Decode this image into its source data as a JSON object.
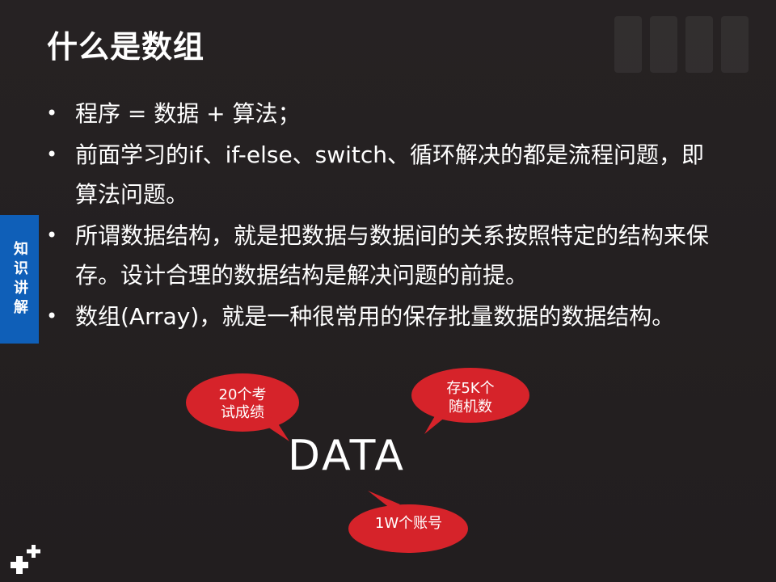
{
  "slide": {
    "title": "什么是数组",
    "bullets": [
      "程序 = 数据 + 算法；",
      "前面学习的if、if-else、switch、循环解决的都是流程问题，即算法问题。",
      "所谓数据结构，就是把数据与数据间的关系按照特定的结构来保存。设计合理的数据结构是解决问题的前提。",
      "数组(Array)，就是一种很常用的保存批量数据的数据结构。"
    ],
    "side_tab": "知识讲解",
    "center_word": "DATA",
    "bubbles": [
      "20个考\n试成绩",
      "存5K个\n随机数",
      "1W个账号"
    ]
  },
  "colors": {
    "background": "#231f20",
    "side_tab": "#0f5fb8",
    "bubble": "#d6232a"
  },
  "icons": {
    "bullet": "bullet-dot-icon",
    "logo": "plus-logo-icon"
  }
}
